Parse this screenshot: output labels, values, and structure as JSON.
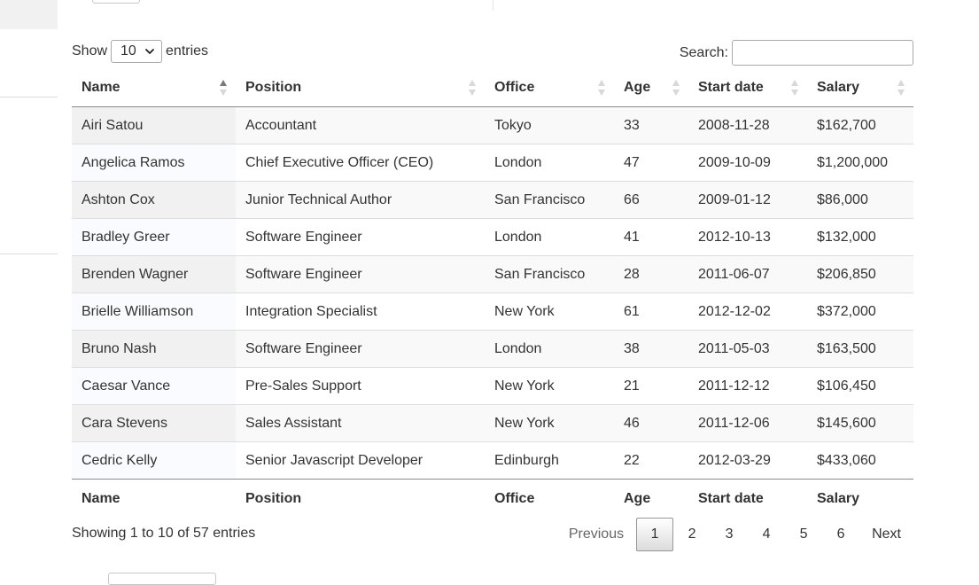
{
  "length": {
    "show_label": "Show",
    "selected": "10",
    "entries_label": "entries"
  },
  "search": {
    "label": "Search:",
    "value": ""
  },
  "columns": [
    "Name",
    "Position",
    "Office",
    "Age",
    "Start date",
    "Salary"
  ],
  "rows": [
    [
      "Airi Satou",
      "Accountant",
      "Tokyo",
      "33",
      "2008-11-28",
      "$162,700"
    ],
    [
      "Angelica Ramos",
      "Chief Executive Officer (CEO)",
      "London",
      "47",
      "2009-10-09",
      "$1,200,000"
    ],
    [
      "Ashton Cox",
      "Junior Technical Author",
      "San Francisco",
      "66",
      "2009-01-12",
      "$86,000"
    ],
    [
      "Bradley Greer",
      "Software Engineer",
      "London",
      "41",
      "2012-10-13",
      "$132,000"
    ],
    [
      "Brenden Wagner",
      "Software Engineer",
      "San Francisco",
      "28",
      "2011-06-07",
      "$206,850"
    ],
    [
      "Brielle Williamson",
      "Integration Specialist",
      "New York",
      "61",
      "2012-12-02",
      "$372,000"
    ],
    [
      "Bruno Nash",
      "Software Engineer",
      "London",
      "38",
      "2011-05-03",
      "$163,500"
    ],
    [
      "Caesar Vance",
      "Pre-Sales Support",
      "New York",
      "21",
      "2011-12-12",
      "$106,450"
    ],
    [
      "Cara Stevens",
      "Sales Assistant",
      "New York",
      "46",
      "2011-12-06",
      "$145,600"
    ],
    [
      "Cedric Kelly",
      "Senior Javascript Developer",
      "Edinburgh",
      "22",
      "2012-03-29",
      "$433,060"
    ]
  ],
  "info": "Showing 1 to 10 of 57 entries",
  "pagination": {
    "previous": "Previous",
    "pages": [
      "1",
      "2",
      "3",
      "4",
      "5",
      "6"
    ],
    "current": "1",
    "next": "Next"
  },
  "sort": {
    "column_index": 0,
    "direction": "ascending"
  }
}
